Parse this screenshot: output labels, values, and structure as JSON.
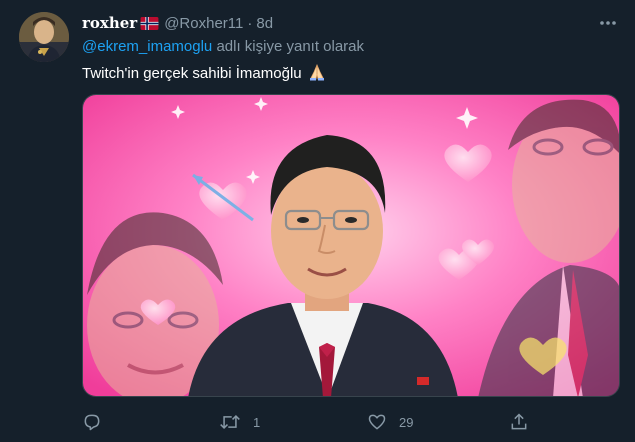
{
  "author": {
    "display_name": "roxher",
    "handle": "@Roxher11",
    "separator": "·",
    "time": "8d",
    "flag_icon": "norway-flag-icon",
    "avatar": "avatar-image"
  },
  "reply": {
    "mention": "@ekrem_imamoglu",
    "suffix": " adlı kişiye yanıt olarak"
  },
  "tweet": {
    "text": "Twitch'in gerçek sahibi İmamoğlu",
    "emoji": "folded-hands-icon"
  },
  "media": {
    "description_icon": "photo",
    "background_color": "#ff5fb0"
  },
  "actions": {
    "reply_count": "",
    "retweet_count": "1",
    "like_count": "29",
    "share_count": ""
  },
  "colors": {
    "background": "#15202b",
    "secondary_text": "#8899a6",
    "link": "#1da1f2",
    "border": "#38444d"
  }
}
